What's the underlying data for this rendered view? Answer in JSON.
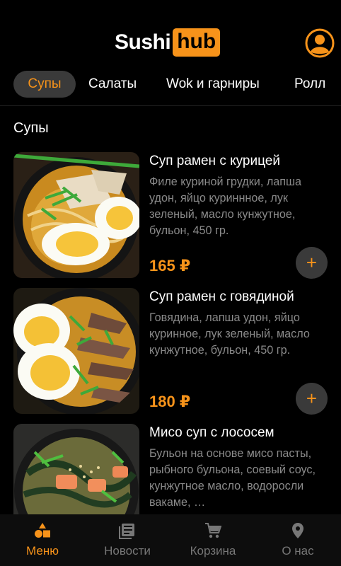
{
  "app": {
    "logo_part1": "Sushi",
    "logo_part2": "hub"
  },
  "colors": {
    "accent": "#f7931a",
    "background": "#000000",
    "muted": "#8a8a8a"
  },
  "tabs": [
    {
      "label": "Супы",
      "active": true
    },
    {
      "label": "Салаты",
      "active": false
    },
    {
      "label": "Wok и гарниры",
      "active": false
    },
    {
      "label": "Ролл",
      "active": false
    }
  ],
  "section_title": "Супы",
  "products": [
    {
      "name": "Суп рамен с курицей",
      "description": "Филе куриной грудки, лапша удон, яйцо куриннное, лук зеленый, масло кунжутное, бульон, 450 гр.",
      "price": "165 ₽",
      "add_label": "+"
    },
    {
      "name": "Суп рамен с говядиной",
      "description": "Говядина, лапша удон, яйцо куринное, лук зеленый, масло кунжутное, бульон, 450 гр.",
      "price": "180 ₽",
      "add_label": "+"
    },
    {
      "name": "Мисо суп с лососем",
      "description": "Бульон на основе мисо пасты, рыбного бульона, соевый соус, кунжутное масло, водоросли вакаме, …",
      "price": "",
      "add_label": "+"
    }
  ],
  "bottom_nav": [
    {
      "label": "Меню",
      "icon": "shapes-icon",
      "active": true
    },
    {
      "label": "Новости",
      "icon": "news-icon",
      "active": false
    },
    {
      "label": "Корзина",
      "icon": "cart-icon",
      "active": false
    },
    {
      "label": "О нас",
      "icon": "location-pin-icon",
      "active": false
    }
  ]
}
